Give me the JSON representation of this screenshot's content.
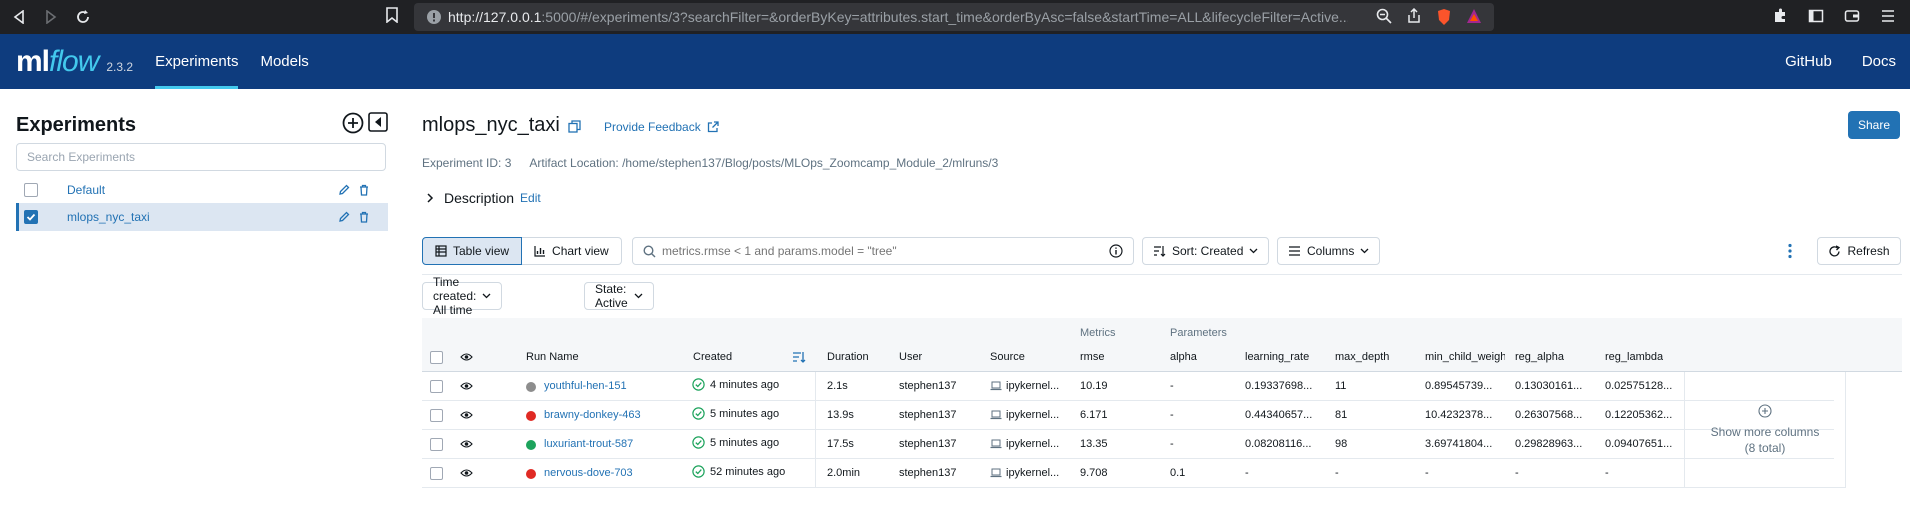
{
  "browser": {
    "url_host": "http://127.0.0.1",
    "url_rest": ":5000/#/experiments/3?searchFilter=&orderByKey=attributes.start_time&orderByAsc=false&startTime=ALL&lifecycleFilter=Active..."
  },
  "header": {
    "logo_ml": "ml",
    "logo_flow": "flow",
    "version": "2.3.2",
    "nav": [
      "Experiments",
      "Models"
    ],
    "right": [
      "GitHub",
      "Docs"
    ]
  },
  "sidebar": {
    "title": "Experiments",
    "search_placeholder": "Search Experiments",
    "items": [
      {
        "name": "Default",
        "checked": false
      },
      {
        "name": "mlops_nyc_taxi",
        "checked": true
      }
    ]
  },
  "experiment": {
    "title": "mlops_nyc_taxi",
    "feedback": "Provide Feedback",
    "share": "Share",
    "id_text": "Experiment ID: 3",
    "artifact_text": "Artifact Location: /home/stephen137/Blog/posts/MLOps_Zoomcamp_Module_2/mlruns/3",
    "description": "Description",
    "edit": "Edit"
  },
  "toolbar": {
    "table_view": "Table view",
    "chart_view": "Chart view",
    "search_placeholder": "metrics.rmse < 1 and params.model = \"tree\"",
    "sort": "Sort: Created",
    "columns": "Columns",
    "refresh": "Refresh",
    "time_filter": "Time created: All time",
    "state_filter": "State: Active"
  },
  "table": {
    "group_metrics": "Metrics",
    "group_params": "Parameters",
    "columns": [
      "Run Name",
      "Created",
      "Duration",
      "User",
      "Source",
      "rmse",
      "alpha",
      "learning_rate",
      "max_depth",
      "min_child_weigh",
      "reg_alpha",
      "reg_lambda"
    ],
    "rows": [
      {
        "status_color": "#8d8d8d",
        "name": "youthful-hen-151",
        "created": "4 minutes ago",
        "duration": "2.1s",
        "user": "stephen137",
        "source": "ipykernel...",
        "rmse": "10.19",
        "alpha": "-",
        "learning_rate": "0.19337698...",
        "max_depth": "11",
        "min_child": "0.89545739...",
        "reg_alpha": "0.13030161...",
        "reg_lambda": "0.02575128..."
      },
      {
        "status_color": "#e02a24",
        "name": "brawny-donkey-463",
        "created": "5 minutes ago",
        "duration": "13.9s",
        "user": "stephen137",
        "source": "ipykernel...",
        "rmse": "6.171",
        "alpha": "-",
        "learning_rate": "0.44340657...",
        "max_depth": "81",
        "min_child": "10.4232378...",
        "reg_alpha": "0.26307568...",
        "reg_lambda": "0.12205362..."
      },
      {
        "status_color": "#1da35c",
        "name": "luxuriant-trout-587",
        "created": "5 minutes ago",
        "duration": "17.5s",
        "user": "stephen137",
        "source": "ipykernel...",
        "rmse": "13.35",
        "alpha": "-",
        "learning_rate": "0.08208116...",
        "max_depth": "98",
        "min_child": "3.69741804...",
        "reg_alpha": "0.29828963...",
        "reg_lambda": "0.09407651..."
      },
      {
        "status_color": "#e02a24",
        "name": "nervous-dove-703",
        "created": "52 minutes ago",
        "duration": "2.0min",
        "user": "stephen137",
        "source": "ipykernel...",
        "rmse": "9.708",
        "alpha": "0.1",
        "learning_rate": "-",
        "max_depth": "-",
        "min_child": "-",
        "reg_alpha": "-",
        "reg_lambda": "-"
      }
    ],
    "show_more": "Show more columns",
    "show_more_count": "(8 total)"
  },
  "colors": {
    "brand": "#0e3c7e",
    "accent": "#2272b4",
    "success": "#1da35c"
  }
}
